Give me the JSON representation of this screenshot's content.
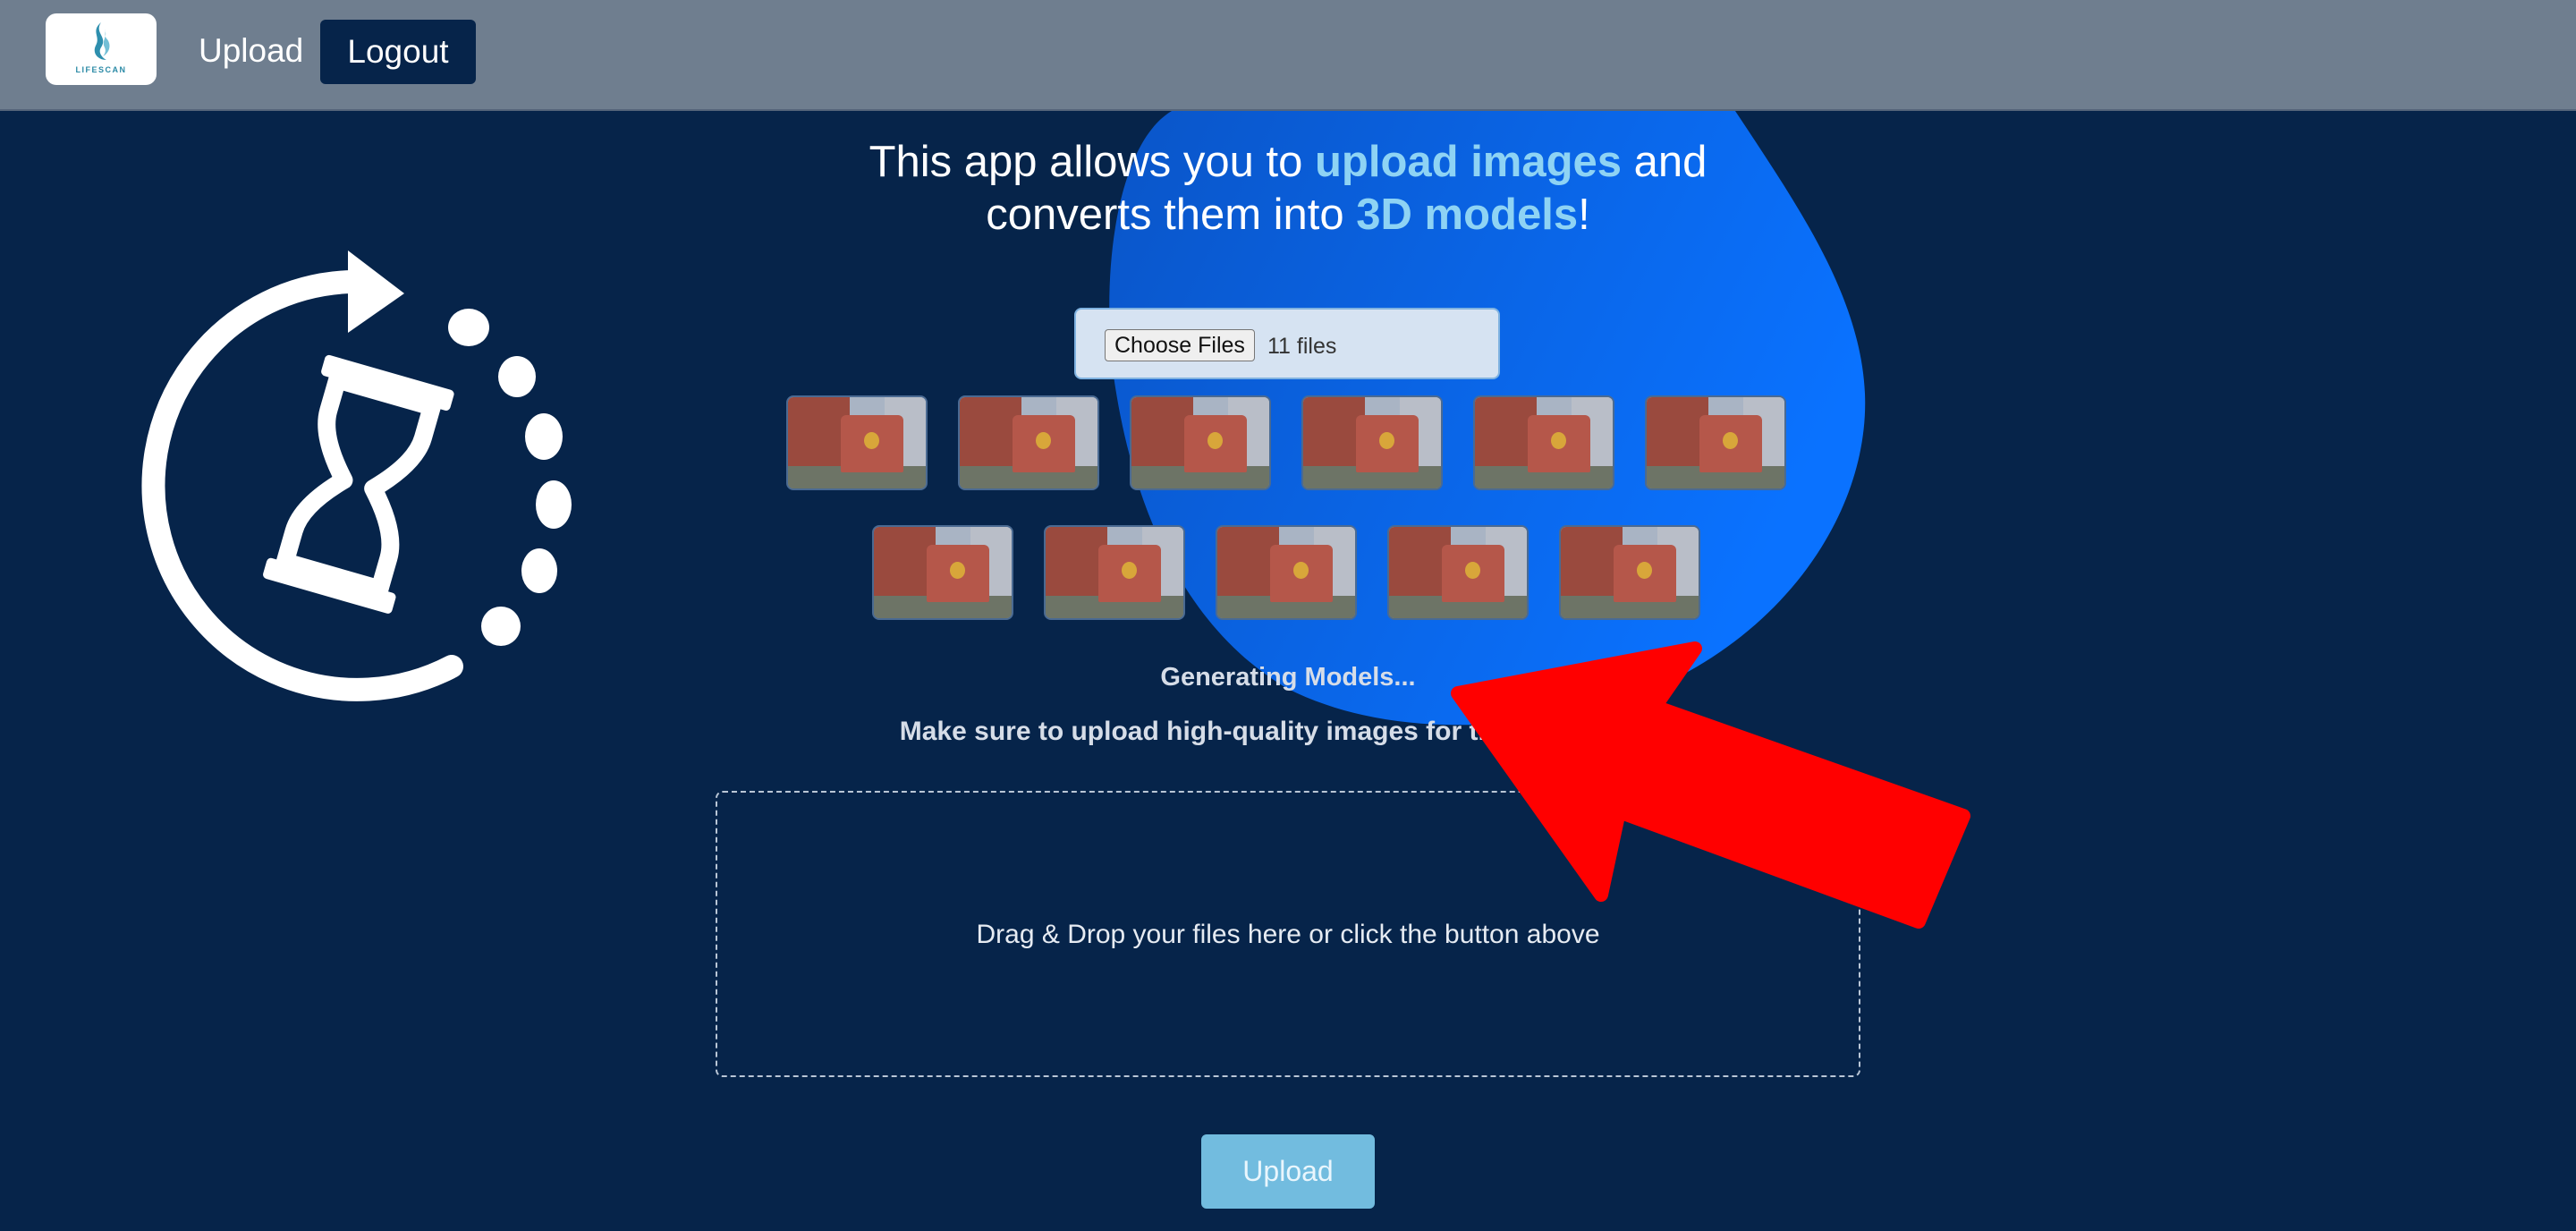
{
  "app": {
    "logo_text": "LIFESCAN"
  },
  "nav": {
    "upload_label": "Upload",
    "logout_label": "Logout"
  },
  "headline": {
    "part1": "This app allows you to ",
    "highlight1": "upload images",
    "part2": " and",
    "part3": "converts them into ",
    "highlight2": "3D models",
    "part4": "!"
  },
  "file_input": {
    "button_label": "Choose Files",
    "selection_text": "11 files"
  },
  "thumbnails": {
    "count": 11
  },
  "status": {
    "generating": "Generating Models...",
    "tip": "Make sure to upload high-quality images for the best results!"
  },
  "dropzone": {
    "text": "Drag & Drop your files here or click the button above"
  },
  "upload_button": {
    "label": "Upload"
  },
  "colors": {
    "background": "#06244a",
    "topbar": "#6f7e8f",
    "highlight": "#8ed3f4",
    "blob": "#0a6cf0",
    "arrow": "#ff0000",
    "upload_button": "#72bcdf"
  },
  "icons": {
    "loading": "hourglass-refresh-icon",
    "annotation": "red-arrow-icon"
  }
}
